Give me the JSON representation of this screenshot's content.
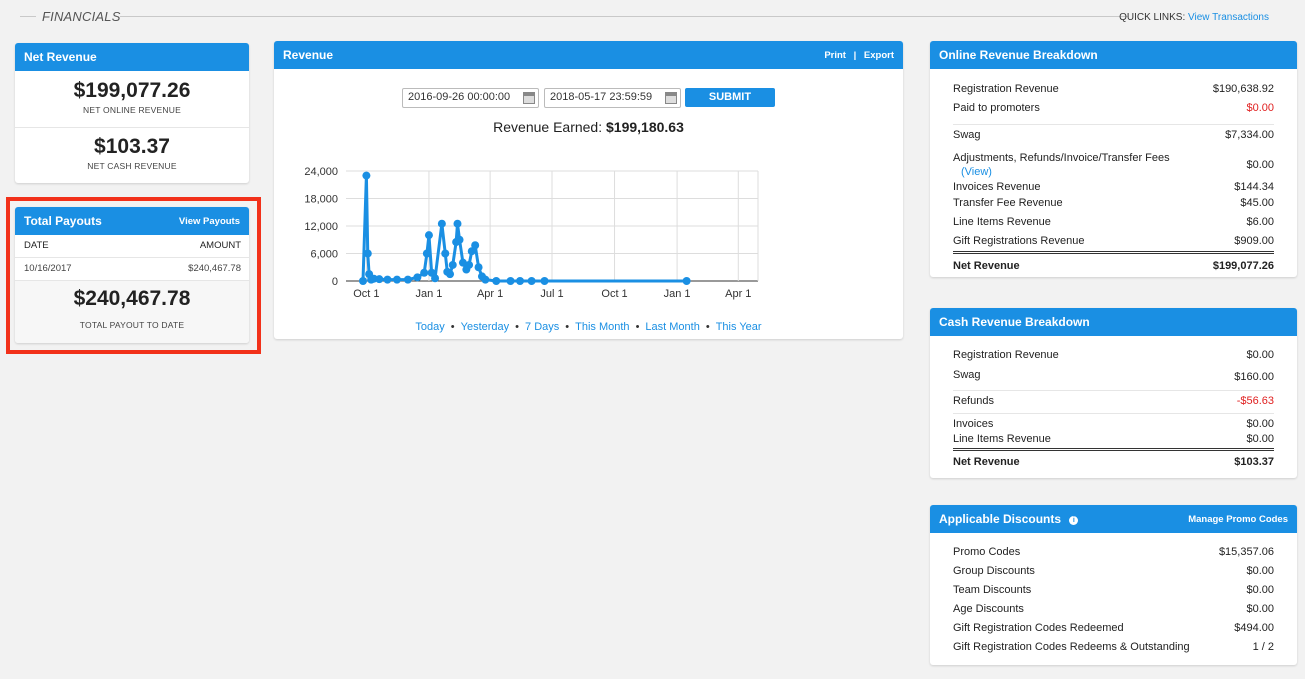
{
  "header": {
    "title": "FINANCIALS",
    "quick_links_label": "QUICK LINKS:",
    "quick_links_view": "View Transactions"
  },
  "net_revenue": {
    "title": "Net Revenue",
    "online_value": "$199,077.26",
    "online_label": "NET ONLINE REVENUE",
    "cash_value": "$103.37",
    "cash_label": "NET CASH REVENUE"
  },
  "payouts": {
    "title": "Total Payouts",
    "view_link": "View Payouts",
    "col_date": "DATE",
    "col_amount": "AMOUNT",
    "rows": [
      {
        "date": "10/16/2017",
        "amount": "$240,467.78"
      }
    ],
    "total_value": "$240,467.78",
    "total_label": "TOTAL PAYOUT TO DATE"
  },
  "revenue": {
    "title": "Revenue",
    "print_label": "Print",
    "separator": "|",
    "export_label": "Export",
    "start_date": "2016-09-26 00:00:00",
    "end_date": "2018-05-17 23:59:59",
    "submit_label": "SUBMIT",
    "earned_label": "Revenue Earned:",
    "earned_value": "$199,180.63",
    "ranges": [
      "Today",
      "Yesterday",
      "7 Days",
      "This Month",
      "Last Month",
      "This Year"
    ]
  },
  "chart_data": {
    "type": "line",
    "title": "",
    "xlabel": "",
    "ylabel": "",
    "ylim": [
      0,
      24000
    ],
    "y_ticks": [
      "24,000",
      "18,000",
      "12,000",
      "6,000",
      "0"
    ],
    "x_ticks": [
      "Oct 1",
      "Jan 1",
      "Apr 1",
      "Jul 1",
      "Oct 1",
      "Jan 1",
      "Apr 1"
    ],
    "grid": true,
    "color": "#1a8fe3",
    "series": [
      {
        "x": [
          "2016-09-26",
          "2016-10-01",
          "2016-10-03",
          "2016-10-05",
          "2016-10-08",
          "2016-10-12",
          "2016-10-20",
          "2016-11-01",
          "2016-11-15",
          "2016-12-01",
          "2016-12-15",
          "2016-12-25",
          "2016-12-29",
          "2017-01-01",
          "2017-01-05",
          "2017-01-10",
          "2017-01-20",
          "2017-01-25",
          "2017-01-28",
          "2017-02-01",
          "2017-02-05",
          "2017-02-10",
          "2017-02-12",
          "2017-02-15",
          "2017-02-20",
          "2017-02-25",
          "2017-03-01",
          "2017-03-05",
          "2017-03-10",
          "2017-03-15",
          "2017-03-20",
          "2017-03-25",
          "2017-04-10",
          "2017-05-01",
          "2017-05-15",
          "2017-06-01",
          "2017-06-20",
          "2018-01-15"
        ],
        "y": [
          0,
          23000,
          6000,
          1500,
          300,
          500,
          400,
          300,
          300,
          300,
          800,
          1800,
          6000,
          10000,
          1800,
          600,
          12500,
          6000,
          2000,
          1500,
          3500,
          8500,
          12500,
          9000,
          4000,
          2500,
          3500,
          6500,
          7800,
          3000,
          1000,
          300,
          0,
          0,
          0,
          0,
          0,
          0
        ]
      }
    ]
  },
  "online_breakdown": {
    "title": "Online Revenue Breakdown",
    "rows": [
      {
        "label": "Registration Revenue",
        "value": "$190,638.92",
        "negative": false
      },
      {
        "label": "Paid to promoters",
        "value": "$0.00",
        "negative": true
      },
      {
        "label": "Swag",
        "value": "$7,334.00",
        "negative": false
      },
      {
        "label": "Adjustments, Refunds/Invoice/Transfer Fees",
        "value": "$0.00",
        "negative": false,
        "view": "(View)"
      },
      {
        "label": "Invoices Revenue",
        "value": "$144.34",
        "negative": false
      },
      {
        "label": "Transfer Fee Revenue",
        "value": "$45.00",
        "negative": false
      },
      {
        "label": "Line Items Revenue",
        "value": "$6.00",
        "negative": false
      },
      {
        "label": "Gift Registrations Revenue",
        "value": "$909.00",
        "negative": false
      }
    ],
    "total_label": "Net Revenue",
    "total_value": "$199,077.26"
  },
  "cash_breakdown": {
    "title": "Cash Revenue Breakdown",
    "rows": [
      {
        "label": "Registration Revenue",
        "value": "$0.00",
        "negative": false
      },
      {
        "label": "Swag",
        "value": "$160.00",
        "negative": false
      },
      {
        "label": "Refunds",
        "value": "-$56.63",
        "negative": true
      },
      {
        "label": "Invoices",
        "value": "$0.00",
        "negative": false
      },
      {
        "label": "Line Items Revenue",
        "value": "$0.00",
        "negative": false
      }
    ],
    "total_label": "Net Revenue",
    "total_value": "$103.37"
  },
  "discounts": {
    "title": "Applicable Discounts",
    "info_icon": "info-icon",
    "manage_link": "Manage Promo Codes",
    "rows": [
      {
        "label": "Promo Codes",
        "value": "$15,357.06"
      },
      {
        "label": "Group Discounts",
        "value": "$0.00"
      },
      {
        "label": "Team Discounts",
        "value": "$0.00"
      },
      {
        "label": "Age Discounts",
        "value": "$0.00"
      },
      {
        "label": "Gift Registration Codes Redeemed",
        "value": "$494.00"
      },
      {
        "label": "Gift Registration Codes Redeems & Outstanding",
        "value": "1 / 2"
      }
    ]
  }
}
